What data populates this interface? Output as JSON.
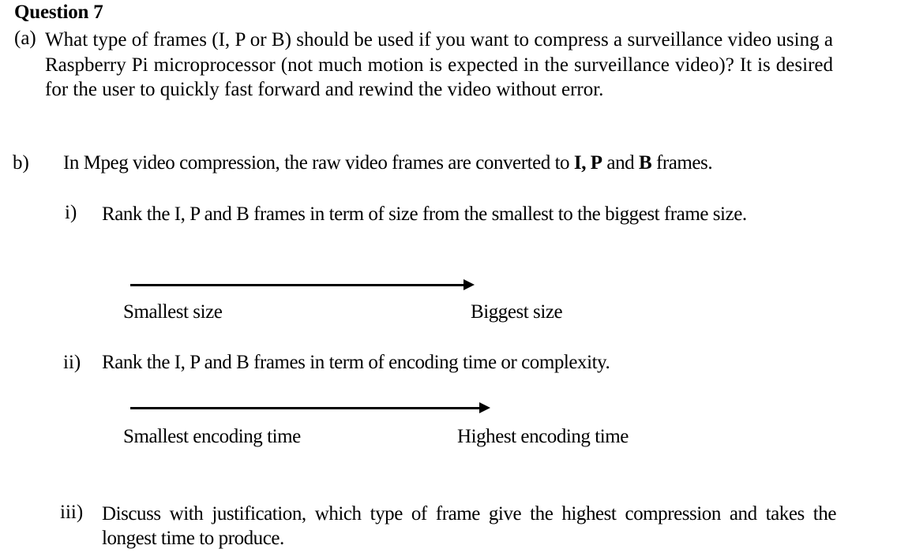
{
  "question": {
    "title": "Question 7",
    "part_a": {
      "label": "(a)",
      "text": "What type of frames (I, P or B) should be used if you want to compress a surveillance video using a Raspberry Pi microprocessor (not much motion is expected in the surveillance video)? It is desired for the user to quickly fast forward and rewind the video without error."
    },
    "part_b": {
      "label": "b)",
      "intro_before": "In Mpeg video compression, the raw video frames are converted to ",
      "intro_bold_1": "I, P",
      "intro_mid_1": " and ",
      "intro_bold_2": "B",
      "intro_after": " frames.",
      "sub_i": {
        "label": "i)",
        "text": "Rank the I, P and B frames in term of size from the smallest to the biggest frame size.",
        "arrow_start_label": "Smallest size",
        "arrow_end_label": "Biggest size"
      },
      "sub_ii": {
        "label": "ii)",
        "text": "Rank the I, P and B frames in term of encoding time or complexity.",
        "arrow_start_label": "Smallest encoding time",
        "arrow_end_label": "Highest encoding time"
      },
      "sub_iii": {
        "label": "iii)",
        "text": "Discuss with justification, which type of frame give the highest compression and takes the longest time to produce."
      }
    }
  }
}
